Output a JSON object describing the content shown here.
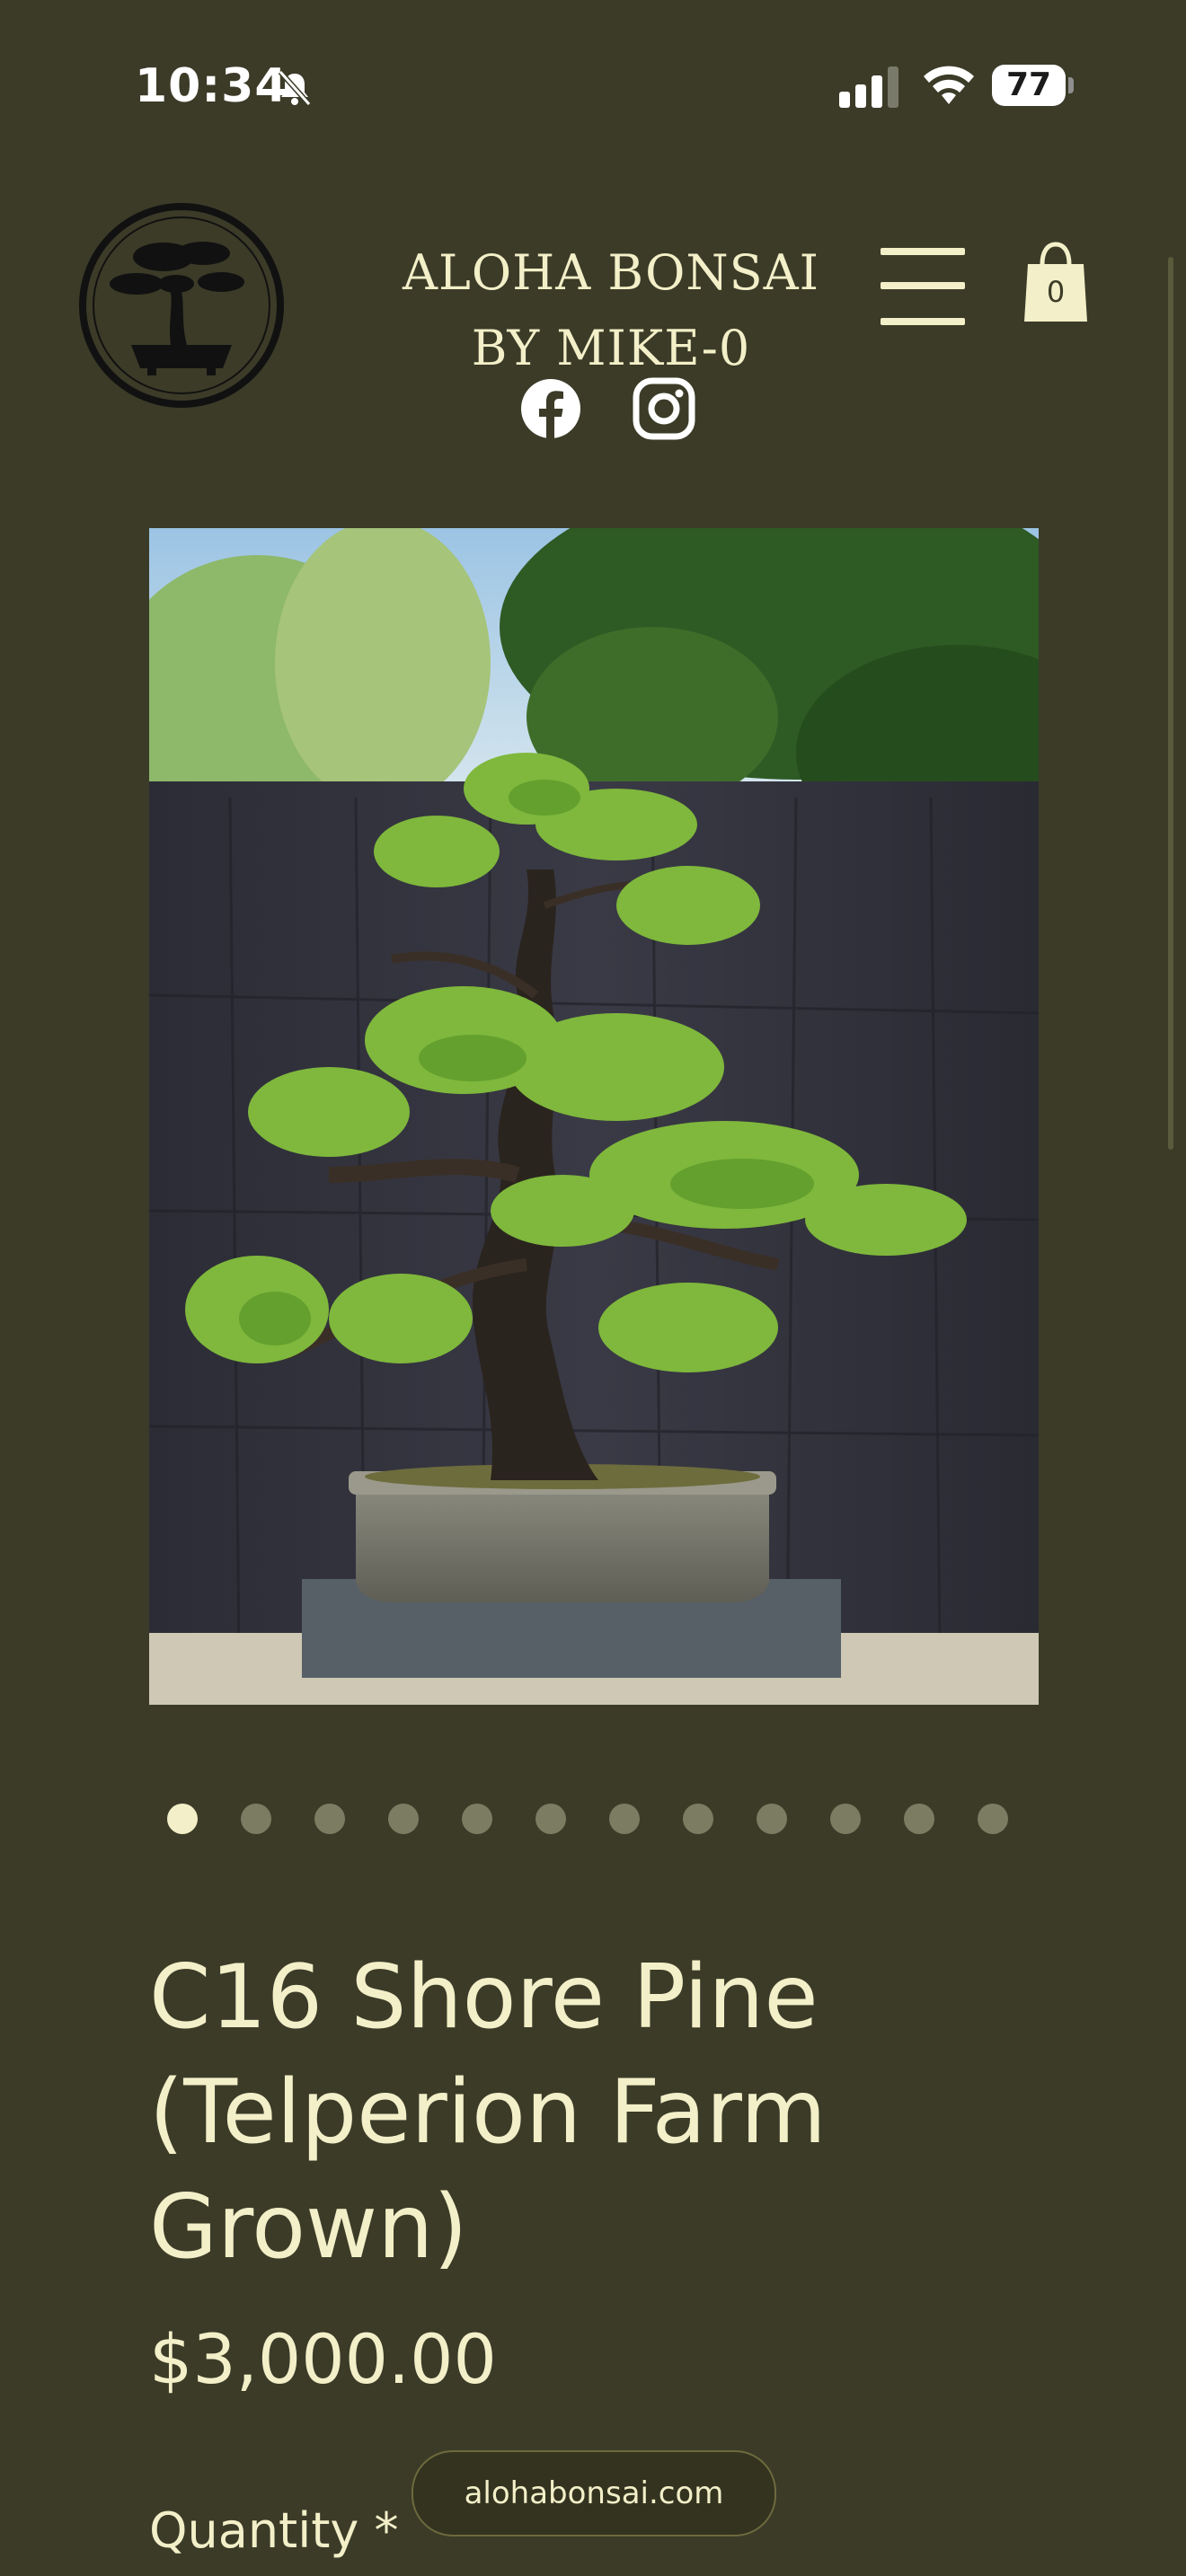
{
  "status_bar": {
    "time": "10:34",
    "battery_level": "77"
  },
  "header": {
    "brand_line1": "ALOHA BONSAI",
    "brand_line2": "BY MIKE-0",
    "cart_count": "0"
  },
  "gallery": {
    "image_count": 12,
    "active_index": 0
  },
  "product": {
    "title": "C16 Shore Pine (Telperion Farm Grown)",
    "price": "$3,000.00",
    "quantity_label": "Quantity *"
  },
  "browser": {
    "domain": "alohabonsai.com"
  },
  "colors": {
    "background": "#3b3b28",
    "text": "#f3efc8",
    "accent_pill": "#333320"
  },
  "icons": [
    "bell-muted-icon",
    "signal-icon",
    "wifi-icon",
    "battery-icon",
    "logo-bonsai",
    "facebook-icon",
    "instagram-icon",
    "hamburger-menu-icon",
    "shopping-bag-icon"
  ]
}
